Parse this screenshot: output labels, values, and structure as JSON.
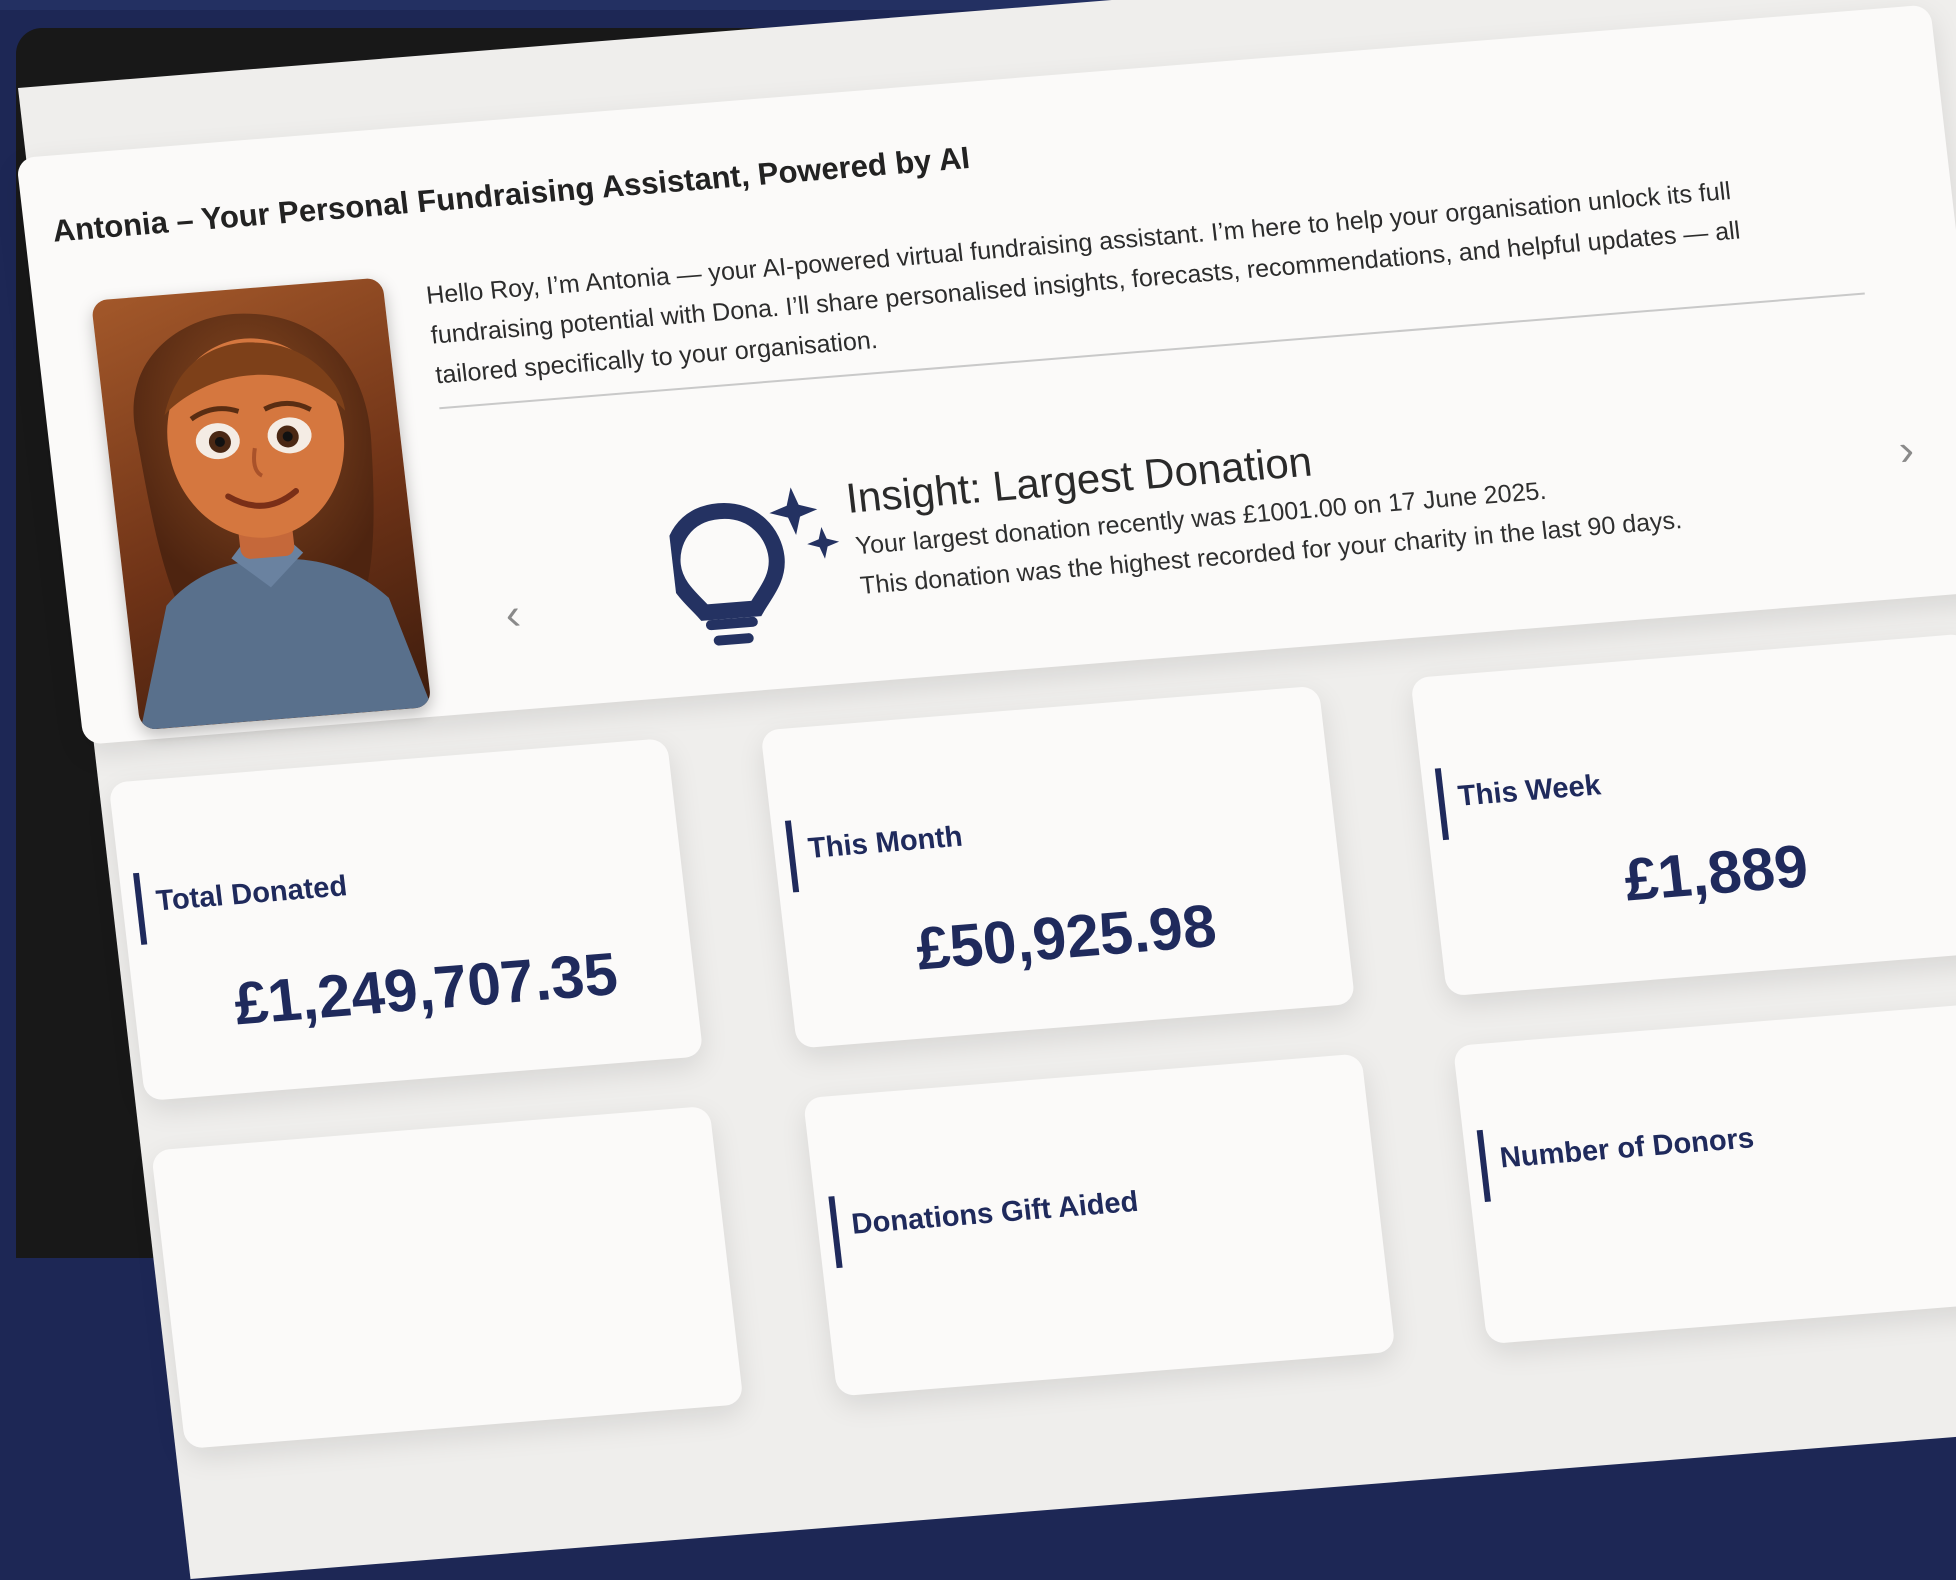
{
  "hero": {
    "title": "Antonia – Your Personal Fundraising Assistant, Powered by AI",
    "intro": "Hello Roy, I’m Antonia — your AI-powered virtual fundraising assistant. I’m here to help your organisation unlock its full fundraising potential with Dona. I’ll share personalised insights, forecasts, recommendations, and helpful updates — all tailored specifically to your organisation."
  },
  "insight": {
    "title": "Insight: Largest Donation",
    "line1": "Your largest donation recently was £1001.00 on 17 June 2025.",
    "line2": "This donation was the highest recorded for your charity in the last 90 days.",
    "prev_icon": "chevron-left-icon",
    "next_icon": "chevron-right-icon"
  },
  "stats": [
    {
      "label": "Total Donated",
      "value": "£1,249,707.35"
    },
    {
      "label": "This Month",
      "value": "£50,925.98"
    },
    {
      "label": "This Week",
      "value": "£1,889"
    },
    {
      "label": "Donations Gift Aided",
      "value": ""
    },
    {
      "label": "Number of Donors",
      "value": ""
    }
  ],
  "colors": {
    "accent": "#1f2a5c",
    "background": "#1d2755",
    "card": "#fbfaf9"
  }
}
